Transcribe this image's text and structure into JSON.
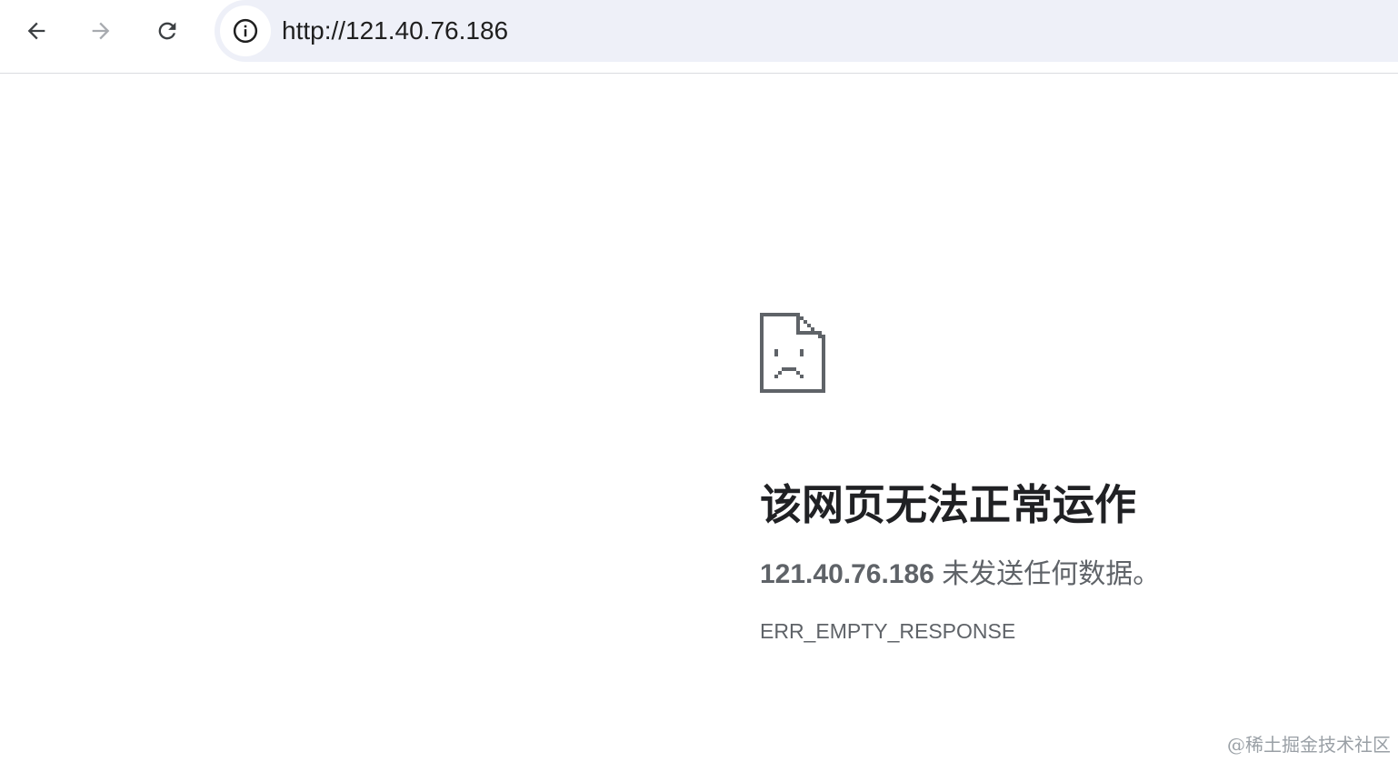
{
  "toolbar": {
    "back_icon": "arrow-left-icon",
    "forward_icon": "arrow-right-icon",
    "reload_icon": "reload-icon",
    "site_info_icon": "info-circle-icon",
    "url": "http://121.40.76.186"
  },
  "error": {
    "icon": "sad-document-icon",
    "title": "该网页无法正常运作",
    "host": "121.40.76.186",
    "message": " 未发送任何数据。",
    "code": "ERR_EMPTY_RESPONSE"
  },
  "watermark": "@稀土掘金技术社区",
  "colors": {
    "omnibox_bg": "#eef0f8",
    "title_text": "#202124",
    "secondary_text": "#5f6368",
    "icon_gray": "#5f6368"
  }
}
